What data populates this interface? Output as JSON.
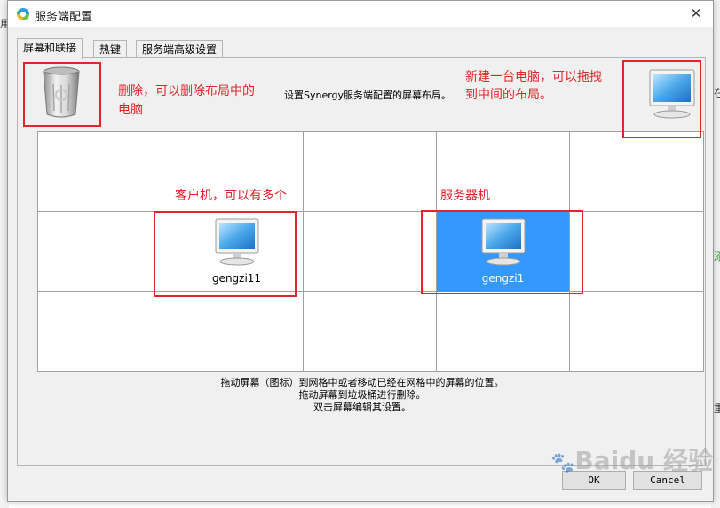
{
  "window": {
    "title": "服务端配置",
    "close_glyph": "✕"
  },
  "tabs": [
    {
      "label": "屏幕和联接",
      "active": true
    },
    {
      "label": "热键",
      "active": false
    },
    {
      "label": "服务端高级设置",
      "active": false
    }
  ],
  "help_top": "设置Synergy服务端配置的屏幕布局。",
  "grid": {
    "rows": 3,
    "cols": 5,
    "screens": [
      {
        "name": "gengzi11",
        "row": 1,
        "col": 1,
        "selected": false
      },
      {
        "name": "gengzi1",
        "row": 1,
        "col": 3,
        "selected": true
      }
    ]
  },
  "help_bottom": [
    "拖动屏幕（图标）到网格中或者移动已经在网格中的屏幕的位置。",
    "拖动屏幕到垃圾桶进行删除。",
    "双击屏幕编辑其设置。"
  ],
  "buttons": {
    "ok": "OK",
    "cancel": "Cancel"
  },
  "annotations": {
    "trash_line1": "删除，可以删除布局中的",
    "trash_line2": "电脑",
    "new_line1": "新建一台电脑，可以拖拽",
    "new_line2": "到中间的布局。",
    "client": "客户机，可以有多个",
    "server": "服务器机"
  },
  "background": {
    "left_char": "用",
    "right_char_1": "在",
    "right_char_2": "添",
    "right_char_3": "重"
  },
  "watermark": {
    "text": "Baidu 经验",
    "paw": "🐾"
  },
  "colors": {
    "annotation_red": "#e0262b",
    "selection_blue": "#3399ff"
  },
  "icons": {
    "trash": "trash-icon",
    "monitor": "monitor-icon",
    "app": "synergy-icon"
  }
}
